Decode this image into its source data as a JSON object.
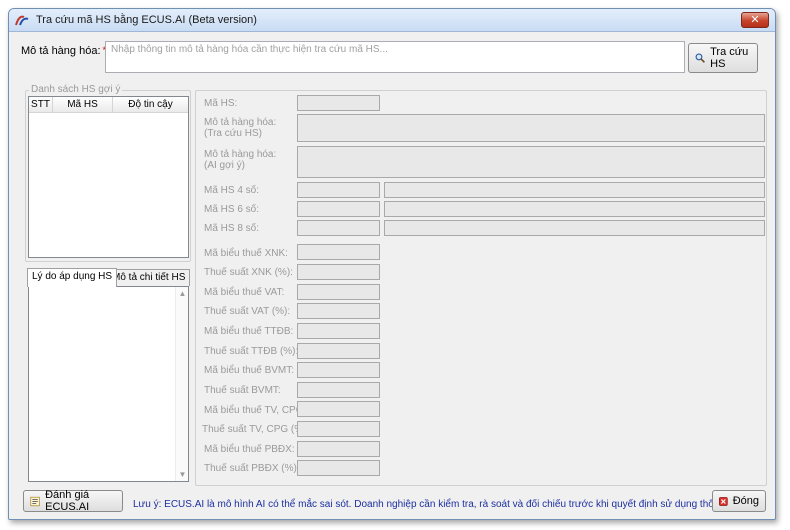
{
  "window": {
    "title": "Tra cứu mã HS bằng ECUS.AI (Beta version)",
    "close_glyph": "✕"
  },
  "search": {
    "label": "Mô tả hàng hóa:",
    "required_mark": "*",
    "placeholder": "Nhập thông tin mô tả hàng hóa cần thực hiện tra cứu mã HS...",
    "value": "",
    "button_label": "Tra cứu HS"
  },
  "suggestions": {
    "title": "Danh sách HS gợi ý",
    "columns": [
      "STT",
      "Mã HS",
      "Độ tin cậy"
    ],
    "rows": []
  },
  "tabs": [
    {
      "label": "Lý do áp dụng HS",
      "active": true
    },
    {
      "label": "Mô tả chi tiết HS",
      "active": false
    }
  ],
  "details": {
    "ma_hs": "Mã HS:",
    "mo_ta_tra_cuu_line1": "Mô tả hàng hóa:",
    "mo_ta_tra_cuu_line2": "(Tra cứu HS)",
    "mo_ta_ai_line1": "Mô tả hàng hóa:",
    "mo_ta_ai_line2": "(AI gợi ý)",
    "ma_hs_4": "Mã HS 4 số:",
    "ma_hs_6": "Mã HS 6 số:",
    "ma_hs_8": "Mã HS 8 số:",
    "ma_bieu_xnk": "Mã biểu thuế XNK:",
    "thue_suat_xnk": "Thuế suất XNK (%):",
    "ma_bieu_vat": "Mã biểu thuế VAT:",
    "thue_suat_vat": "Thuế suất VAT (%):",
    "ma_bieu_ttdb": "Mã biểu thuế TTĐB:",
    "thue_suat_ttdb": "Thuế suất TTĐB (%):",
    "ma_bieu_bvmt": "Mã biểu thuế BVMT:",
    "thue_suat_bvmt": "Thuế suất BVMT:",
    "ma_bieu_tv": "Mã biểu thuế TV, CPG:",
    "thue_suat_tv": "Thuế suất TV, CPG (%):",
    "ma_bieu_pbdx": "Mã biểu thuế PBĐX:",
    "thue_suat_pbdx": "Thuế suất PBĐX (%):"
  },
  "footer": {
    "rate_button": "Đánh giá ECUS.AI",
    "note": "Lưu ý: ECUS.AI là mô hình AI có thể mắc sai sót. Doanh nghiệp cần kiểm tra, rà soát và đối chiếu trước khi quyết định sử dụng thông tin trên.",
    "close_button": "Đóng"
  },
  "colors": {
    "note_text": "#1c2fa0",
    "disabled_label": "#9a9a9a",
    "field_bg": "#e8e8e8"
  },
  "icons": {
    "title": "ecus-logo-icon",
    "search_button": "magnifier-icon",
    "rate_button": "checklist-icon",
    "close_button": "red-x-icon"
  }
}
